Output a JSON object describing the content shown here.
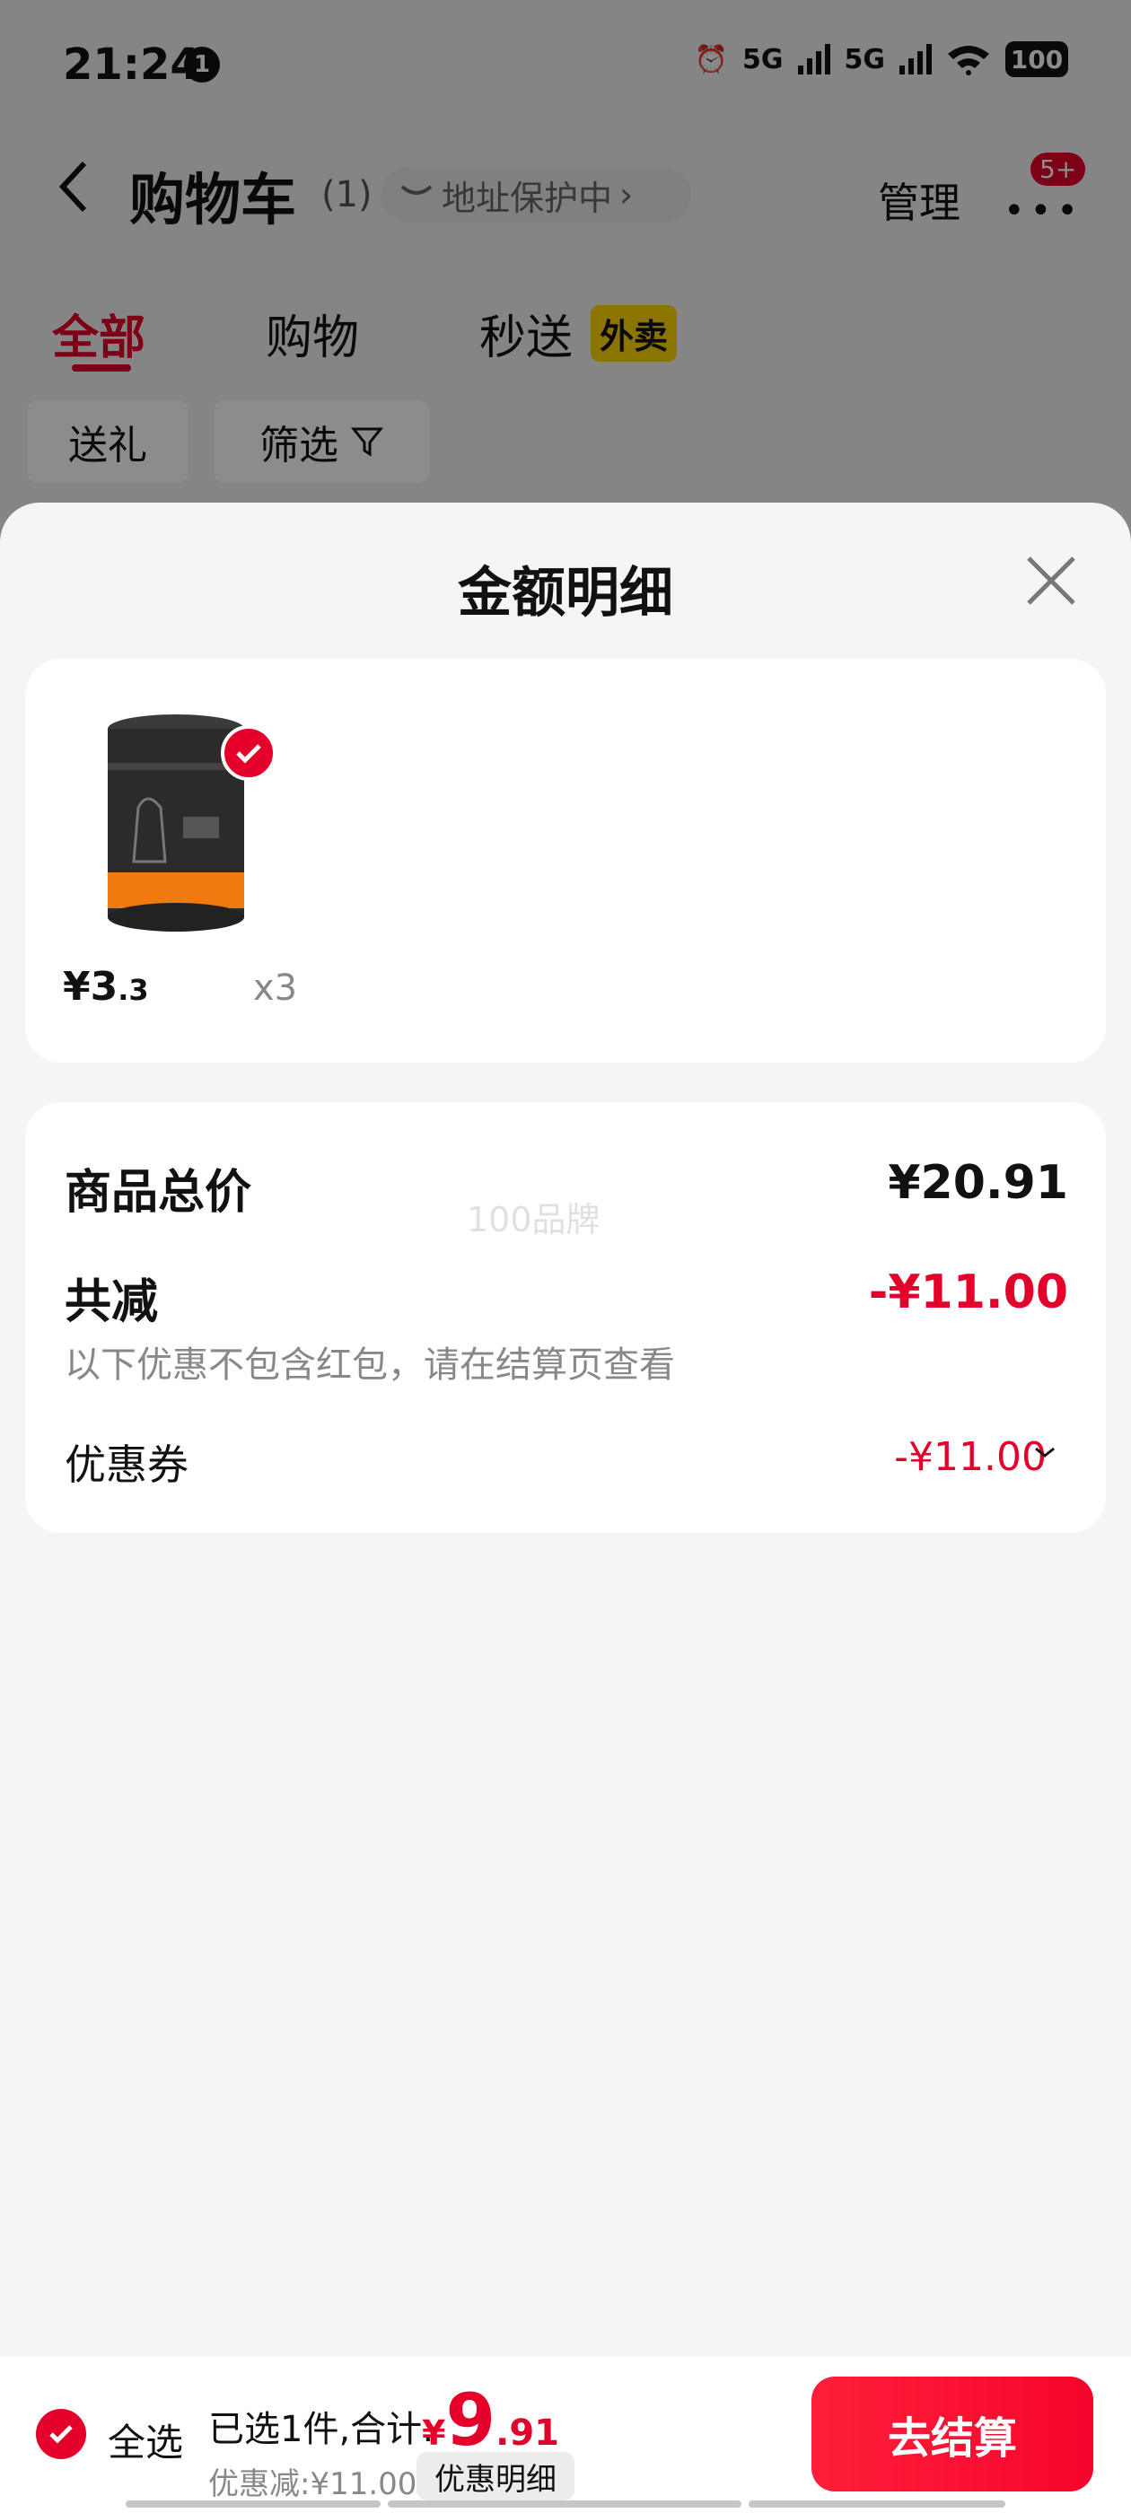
{
  "status_bar": {
    "time": "21:24",
    "notif_count": "1",
    "signal1": "5G",
    "signal2": "5G",
    "battery": "100"
  },
  "header": {
    "back_label": "",
    "title": "购物车",
    "count": "(1)",
    "address": "地址保护中",
    "manage": "管理",
    "more_badge": "5+"
  },
  "tabs": [
    {
      "label": "全部"
    },
    {
      "label": "购物"
    },
    {
      "label": "秒送"
    }
  ],
  "tab_tag": "外卖",
  "chips": [
    {
      "label": "送礼"
    },
    {
      "label": "筛选"
    }
  ],
  "sheet": {
    "title": "金额明细",
    "product": {
      "price_symbol": "¥",
      "price_int": "3",
      "price_dec": ".3",
      "quantity": "x3"
    },
    "watermark": "100品牌",
    "rows": {
      "total_label": "商品总价",
      "total_value": "¥20.91",
      "discount_label": "共减",
      "discount_value": "-¥11.00",
      "note": "以下优惠不包含红包，请在结算页查看",
      "coupon_label": "优惠券",
      "coupon_value": "-¥11.00"
    }
  },
  "bottom": {
    "select_all": "全选",
    "summary": "已选1件,合计:",
    "total_symbol": "¥",
    "total_int": "9",
    "total_dec": ".91",
    "discount_line": "优惠减:¥11.00",
    "detail_chip": "优惠明细",
    "checkout": "去结算"
  },
  "colors": {
    "accent": "#e4002b",
    "tag_yellow": "#ffd400"
  }
}
